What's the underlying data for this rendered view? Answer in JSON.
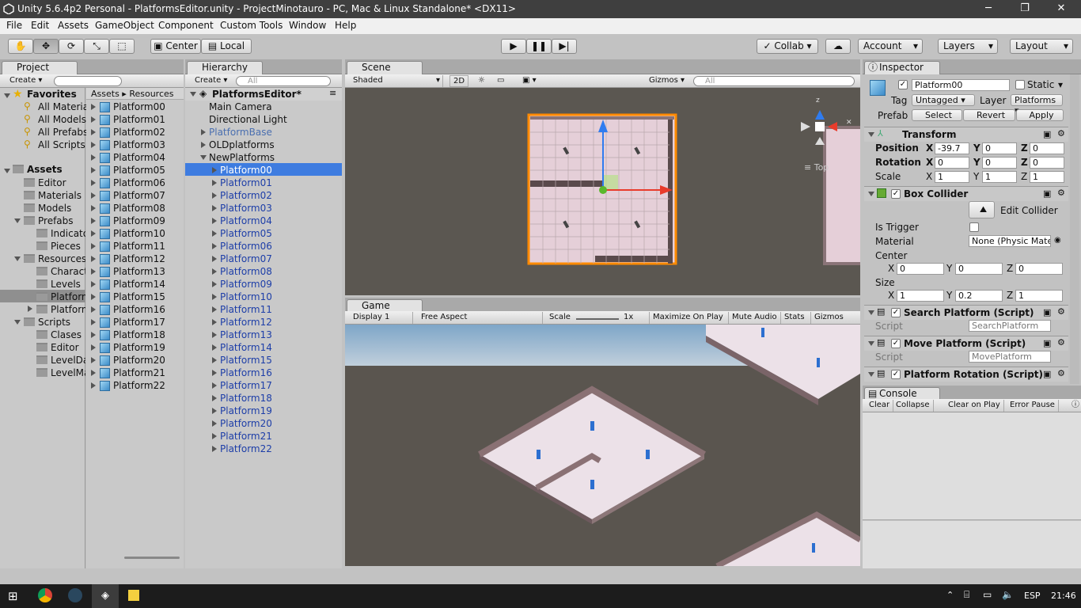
{
  "window": {
    "title": "Unity 5.6.4p2 Personal - PlatformsEditor.unity - ProjectMinotauro - PC, Mac & Linux Standalone* <DX11>",
    "minimize": "─",
    "maximize": "❐",
    "close": "✕"
  },
  "menu": [
    "File",
    "Edit",
    "Assets",
    "GameObject",
    "Component",
    "Custom Tools",
    "Window",
    "Help"
  ],
  "toolbar": {
    "center": "Center",
    "local": "Local",
    "collab": "Collab ▾",
    "account": "Account",
    "layers": "Layers",
    "layout": "Layout"
  },
  "project": {
    "tab": "Project",
    "create": "Create",
    "favorites_title": "Favorites",
    "favorites": [
      "All Materia",
      "All Models",
      "All Prefabs",
      "All Scripts"
    ],
    "assets_title": "Assets",
    "tree": [
      {
        "label": "Editor",
        "indent": 1
      },
      {
        "label": "Materials",
        "indent": 1
      },
      {
        "label": "Models",
        "indent": 1
      },
      {
        "label": "Prefabs",
        "indent": 1,
        "open": true
      },
      {
        "label": "Indicato",
        "indent": 2
      },
      {
        "label": "Pieces",
        "indent": 2
      },
      {
        "label": "Resources",
        "indent": 1,
        "open": true
      },
      {
        "label": "Characte",
        "indent": 2
      },
      {
        "label": "Levels",
        "indent": 2
      },
      {
        "label": "Platform",
        "indent": 2,
        "selected": true
      },
      {
        "label": "Platform",
        "indent": 2,
        "arrow": true
      },
      {
        "label": "Scripts",
        "indent": 1,
        "open": true
      },
      {
        "label": "Clases",
        "indent": 2
      },
      {
        "label": "Editor",
        "indent": 2
      },
      {
        "label": "LevelDat",
        "indent": 2
      },
      {
        "label": "LevelMa",
        "indent": 2
      }
    ],
    "breadcrumb": [
      "Assets",
      "Resources"
    ],
    "files": [
      "Platform00",
      "Platform01",
      "Platform02",
      "Platform03",
      "Platform04",
      "Platform05",
      "Platform06",
      "Platform07",
      "Platform08",
      "Platform09",
      "Platform10",
      "Platform11",
      "Platform12",
      "Platform13",
      "Platform14",
      "Platform15",
      "Platform16",
      "Platform17",
      "Platform18",
      "Platform19",
      "Platform20",
      "Platform21",
      "Platform22"
    ]
  },
  "hierarchy": {
    "tab": "Hierarchy",
    "create": "Create",
    "search_placeholder": "All",
    "scene": "PlatformsEditor*",
    "top": [
      {
        "label": "Main Camera"
      },
      {
        "label": "Directional Light"
      },
      {
        "label": "PlatformBase",
        "arrow": true,
        "prefab": true
      },
      {
        "label": "OLDplatforms",
        "arrow": true
      },
      {
        "label": "NewPlatforms",
        "open": true
      }
    ],
    "platforms": [
      "Platform00",
      "Platform01",
      "Platform02",
      "Platform03",
      "Platform04",
      "Platform05",
      "Platform06",
      "Platform07",
      "Platform08",
      "Platform09",
      "Platform10",
      "Platform11",
      "Platform12",
      "Platform13",
      "Platform14",
      "Platform15",
      "Platform16",
      "Platform17",
      "Platform18",
      "Platform19",
      "Platform20",
      "Platform21",
      "Platform22"
    ]
  },
  "scene": {
    "tab": "Scene",
    "shaded": "Shaded",
    "mode2d": "2D",
    "gizmos": "Gizmos",
    "search_placeholder": "All",
    "view_label": "Top"
  },
  "game": {
    "tab": "Game",
    "display": "Display 1",
    "aspect": "Free Aspect",
    "scale_label": "Scale",
    "scale_value": "1x",
    "maximize": "Maximize On Play",
    "mute": "Mute Audio",
    "stats": "Stats",
    "gizmos": "Gizmos"
  },
  "inspector": {
    "tab": "Inspector",
    "name": "Platform00",
    "static": "Static",
    "tag_label": "Tag",
    "tag": "Untagged",
    "layer_label": "Layer",
    "layer": "Platforms",
    "prefab_label": "Prefab",
    "select": "Select",
    "revert": "Revert",
    "apply": "Apply",
    "transform": {
      "title": "Transform",
      "position": "Position",
      "rotation": "Rotation",
      "scale": "Scale",
      "pos": [
        "-39.7",
        "0",
        "0"
      ],
      "rot": [
        "0",
        "0",
        "0"
      ],
      "scl": [
        "1",
        "1",
        "1"
      ]
    },
    "box": {
      "title": "Box Collider",
      "edit": "Edit Collider",
      "trigger": "Is Trigger",
      "material": "Material",
      "material_value": "None (Physic Mate",
      "center": "Center",
      "center_v": [
        "0",
        "0",
        "0"
      ],
      "size": "Size",
      "size_v": [
        "1",
        "0.2",
        "1"
      ]
    },
    "search": {
      "title": "Search Platform (Script)",
      "script_label": "Script",
      "script": "SearchPlatform"
    },
    "move": {
      "title": "Move Platform (Script)",
      "script_label": "Script",
      "script": "MovePlatform"
    },
    "rotation": {
      "title": "Platform Rotation (Script)"
    },
    "axes": [
      "X",
      "Y",
      "Z"
    ]
  },
  "console": {
    "tab": "Console",
    "clear": "Clear",
    "collapse": "Collapse",
    "clear_on_play": "Clear on Play",
    "error_pause": "Error Pause"
  },
  "taskbar": {
    "lang": "ESP",
    "time": "21:46"
  }
}
